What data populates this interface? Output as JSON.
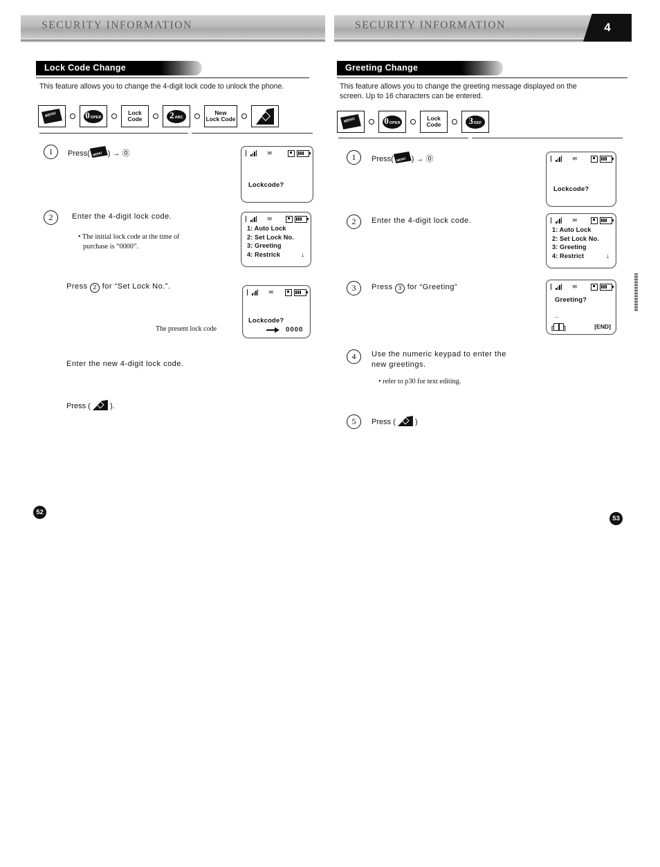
{
  "document": {
    "running_header": "SECURITY INFORMATION",
    "chapter_number": "4"
  },
  "left_page": {
    "page_number": "52",
    "header": "SECURITY INFORMATION",
    "section_title": "Lock Code Change",
    "intro": "This feature allows you to change the 4-digit lock code to unlock the phone.",
    "key_sequence": [
      {
        "type": "menu-key",
        "label": "MENU"
      },
      {
        "type": "oval-key",
        "num": "0",
        "sub": "OPER"
      },
      {
        "type": "text-key",
        "label": "Lock\nCode",
        "line1": "Lock",
        "line2": "Code"
      },
      {
        "type": "oval-key",
        "num": "2",
        "sub": "ABC"
      },
      {
        "type": "text-key",
        "label": "New Lock Code",
        "line1": "New",
        "line2": "Lock Code"
      },
      {
        "type": "end-key",
        "label": "END"
      }
    ],
    "steps": [
      {
        "num": "1",
        "text_prefix": "Press(",
        "text_suffix": ") → ⓪",
        "kind": "press-menu"
      },
      {
        "num": "2",
        "text": "Enter the 4-digit lock code.",
        "bullet": "• The initial lock code at the time of\n  purchase is “0000”."
      },
      {
        "num": "",
        "text": "Press ② for “Set Lock No.”.",
        "circled": "2"
      },
      {
        "num": "",
        "text": "Enter the new 4-digit lock code."
      },
      {
        "num": "",
        "text_prefix": "Press (",
        "text_suffix": ").",
        "kind": "press-send"
      }
    ],
    "bullet_line1": "• The initial lock code at the time of",
    "bullet_line2": "purchase is “0000”.",
    "press_set_lock": "for “Set Lock No.”.",
    "press_word": "Press",
    "enter_new_code": "Enter the new 4-digit lock code.",
    "press_paren_open": "Press (",
    "press_paren_close": ").",
    "caption_present_code": "The present lock code",
    "screens": [
      {
        "name": "lockcode-prompt",
        "line": "Lockcode?"
      },
      {
        "name": "menu-list",
        "items": [
          "1: Auto Lock",
          "2: Set Lock No.",
          "3: Greeting",
          "4: Restrick"
        ],
        "scroll_arrow": "↓"
      },
      {
        "name": "lockcode-value",
        "line": "Lockcode?",
        "value": "0000"
      }
    ]
  },
  "right_page": {
    "page_number": "53",
    "header": "SECURITY INFORMATION",
    "chapter_tab": "4",
    "section_title": "Greeting Change",
    "intro_line1": "This feature allows you to change the greeting message displayed on the",
    "intro_line2": "screen.  Up to 16 characters can be entered.",
    "key_sequence": [
      {
        "type": "menu-key",
        "label": "MENU"
      },
      {
        "type": "oval-key",
        "num": "0",
        "sub": "OPER"
      },
      {
        "type": "text-key",
        "line1": "Lock",
        "line2": "Code"
      },
      {
        "type": "oval-key",
        "num": "3",
        "sub": "DEF"
      }
    ],
    "steps": [
      {
        "num": "1",
        "text_prefix": "Press(",
        "text_suffix": ") → ⓪"
      },
      {
        "num": "2",
        "text": "Enter the 4-digit lock code."
      },
      {
        "num": "3",
        "text": "Press ③ for “Greeting”"
      },
      {
        "num": "4",
        "text_line1": "Use the numeric keypad to enter the",
        "text_line2": "new greetings.",
        "bullet": "• refer to p30 for text editing."
      },
      {
        "num": "5",
        "text_prefix": "Press (",
        "text_suffix": ")"
      }
    ],
    "step3_press": "Press",
    "step3_for": "for “Greeting”",
    "step4_line1": "Use the numeric keypad to enter the",
    "step4_line2": "new greetings.",
    "step4_bullet": "• refer to p30 for text editing.",
    "step5_open": "Press (",
    "step5_close": ")",
    "screens": [
      {
        "name": "lockcode-prompt",
        "line": "Lockcode?"
      },
      {
        "name": "menu-list",
        "items": [
          "1: Auto Lock",
          "2: Set Lock No.",
          "3: Greeting",
          "4: Restrict"
        ],
        "scroll_arrow": "↓"
      },
      {
        "name": "greeting-editor",
        "line": "Greeting?",
        "cursor": "_",
        "soft_left": "[",
        "soft_left_close": "]",
        "soft_right": "[END]"
      }
    ]
  }
}
